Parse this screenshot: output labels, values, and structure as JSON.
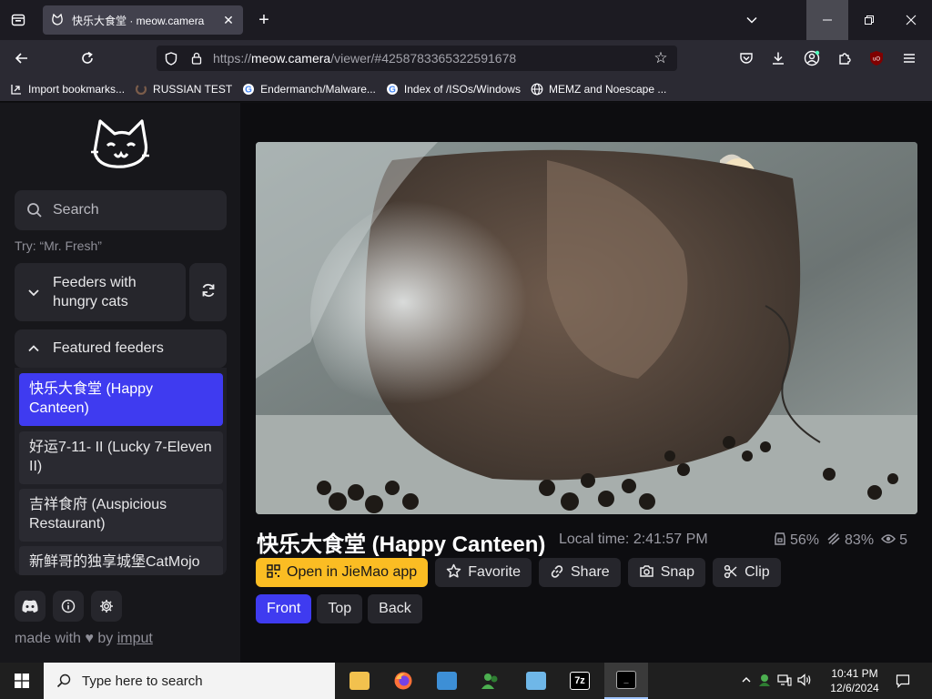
{
  "browser": {
    "tab": {
      "title": "快乐大食堂 · meow.camera",
      "favicon_icon": "cat-face-icon"
    },
    "address": {
      "url_prefix": "https://",
      "url_host": "meow.camera",
      "url_path": "/viewer/#4258783365322591678"
    },
    "bookmarks": [
      {
        "label": "Import bookmarks...",
        "icon": "import-icon"
      },
      {
        "label": "RUSSIAN TEST",
        "icon": "loading-icon"
      },
      {
        "label": "Endermanch/Malware...",
        "icon": "google-icon"
      },
      {
        "label": "Index of /ISOs/Windows",
        "icon": "google-icon"
      },
      {
        "label": "MEMZ and Noescape ...",
        "icon": "globe-icon"
      }
    ]
  },
  "sidebar": {
    "search": {
      "placeholder": "Search"
    },
    "hint": "Try: “Mr. Fresh”",
    "hungry_label": "Feeders with hungry cats",
    "featured_label": "Featured feeders",
    "feeders": [
      {
        "name": "快乐大食堂 (Happy Canteen)",
        "active": true
      },
      {
        "name": "好运7-11- II (Lucky 7-Eleven II)",
        "active": false
      },
      {
        "name": "吉祥食府 (Auspicious Restaurant)",
        "active": false
      },
      {
        "name": "新鲜哥的独享城堡CatMojo",
        "active": false
      }
    ],
    "footer": {
      "made_with": "made with",
      "by": "by",
      "author": "imput"
    }
  },
  "viewer": {
    "title": "快乐大食堂 (Happy Canteen)",
    "local_time": "Local time: 2:41:57 PM",
    "stats": {
      "food": "56%",
      "fullness": "83%",
      "viewers": "5"
    },
    "actions": {
      "open_app": "Open in JieMao app",
      "favorite": "Favorite",
      "share": "Share",
      "snap": "Snap",
      "clip": "Clip"
    },
    "views": {
      "front": "Front",
      "top": "Top",
      "back": "Back",
      "active": "Front"
    }
  },
  "taskbar": {
    "search_placeholder": "Type here to search",
    "time": "10:41 PM",
    "date": "12/6/2024"
  },
  "colors": {
    "accent": "#3f3bf0",
    "app_button": "#fbbd23"
  }
}
